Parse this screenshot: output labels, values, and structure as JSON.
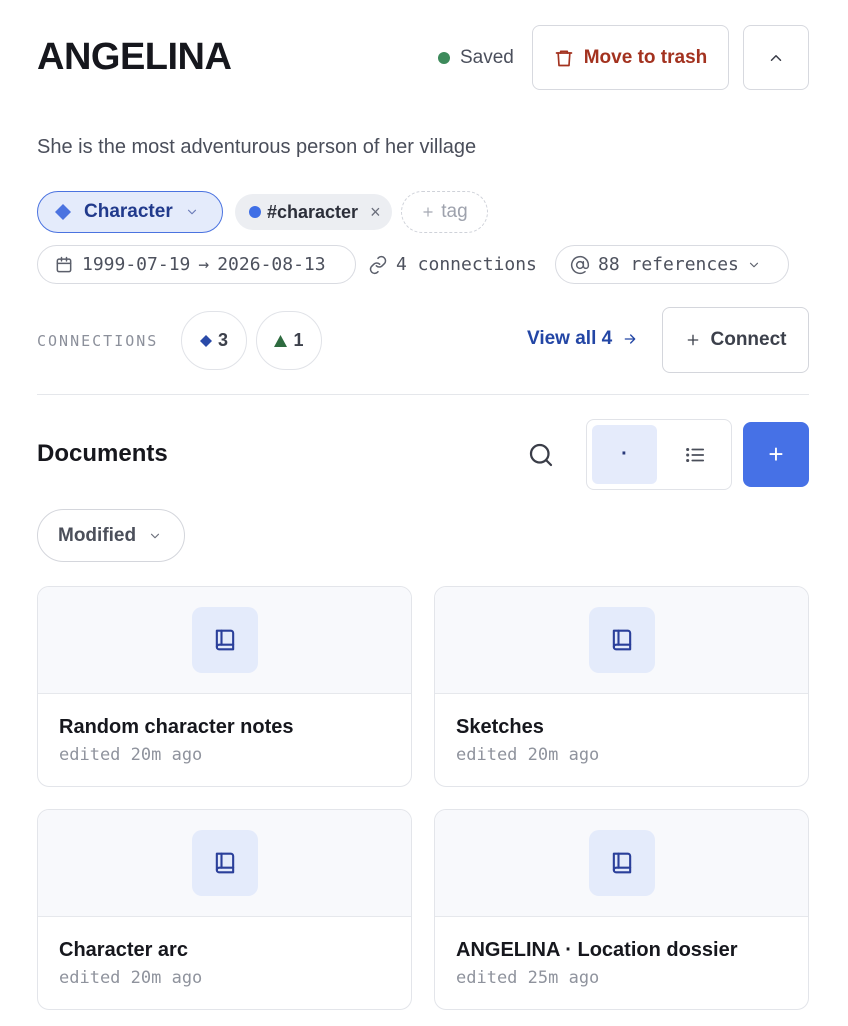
{
  "header": {
    "title": "ANGELINA",
    "status": "Saved",
    "trash_label": "Move to trash"
  },
  "description": "She is the most adventurous person of her village",
  "tags": {
    "type_label": "Character",
    "tag_label": "#character",
    "tag_remove": "×",
    "add_tag_label": "tag"
  },
  "meta": {
    "date_start": "1999-07-19",
    "date_arrow": "→",
    "date_end": "2026-08-13",
    "connections_text": "4 connections",
    "references_text": "88 references"
  },
  "connections": {
    "label": "CONNECTIONS",
    "chips": [
      {
        "count": "3",
        "shape": "diamond",
        "color": "#2a4aa8"
      },
      {
        "count": "1",
        "shape": "triangle",
        "color": "#2e6b3f"
      }
    ],
    "view_all_label": "View all 4",
    "connect_label": "Connect"
  },
  "documents": {
    "title": "Documents",
    "view_grid_glyph": "·",
    "add_label": "+",
    "sort_label": "Modified",
    "cards": [
      {
        "title": "Random character notes",
        "subtitle": "edited 20m ago"
      },
      {
        "title": "Sketches",
        "subtitle": "edited 20m ago"
      },
      {
        "title": "Character arc",
        "subtitle": "edited 20m ago"
      },
      {
        "title": "ANGELINA · Location dossier",
        "subtitle": "edited 25m ago"
      }
    ]
  },
  "colors": {
    "accent": "#4671e6",
    "danger": "#a3321f",
    "saved_dot": "#3d8a5b",
    "link": "#2346a5"
  }
}
